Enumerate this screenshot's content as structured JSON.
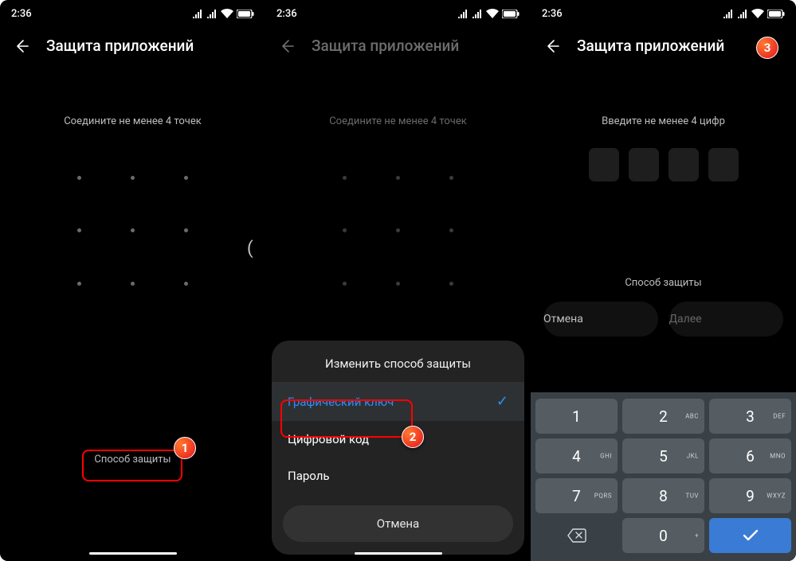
{
  "status": {
    "time": "2:36"
  },
  "header": {
    "title": "Защита приложений"
  },
  "panel1": {
    "instruction": "Соедините не менее 4 точек",
    "method_link": "Способ защиты"
  },
  "panel2": {
    "instruction": "Соедините не менее 4 точек",
    "sheet": {
      "title": "Изменить способ защиты",
      "options": [
        {
          "label": "Графический ключ",
          "selected": true
        },
        {
          "label": "Цифровой код",
          "selected": false
        },
        {
          "label": "Пароль",
          "selected": false
        }
      ],
      "cancel": "Отмена"
    }
  },
  "panel3": {
    "instruction": "Введите не менее 4 цифр",
    "method_link": "Способ защиты",
    "buttons": {
      "cancel": "Отмена",
      "next": "Далее"
    },
    "keypad": [
      [
        {
          "d": "1",
          "s": ""
        },
        {
          "d": "2",
          "s": "ABC"
        },
        {
          "d": "3",
          "s": "DEF"
        }
      ],
      [
        {
          "d": "4",
          "s": "GHI"
        },
        {
          "d": "5",
          "s": "JKL"
        },
        {
          "d": "6",
          "s": "MNO"
        }
      ],
      [
        {
          "d": "7",
          "s": "PQRS"
        },
        {
          "d": "8",
          "s": "TUV"
        },
        {
          "d": "9",
          "s": "WXYZ"
        }
      ],
      [
        {
          "d": "bsp"
        },
        {
          "d": "0",
          "s": "+"
        },
        {
          "d": "ok"
        }
      ]
    ]
  },
  "markers": {
    "m1": "1",
    "m2": "2",
    "m3": "3"
  }
}
